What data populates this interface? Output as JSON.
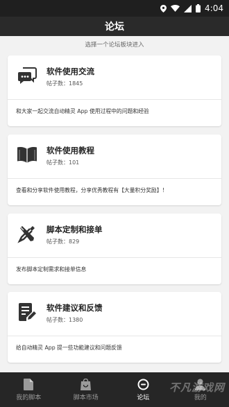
{
  "status_bar": {
    "time": "4:04"
  },
  "header": {
    "title": "论坛"
  },
  "subtitle": "选择一个论坛板块进入",
  "forums": [
    {
      "title": "软件使用交流",
      "count": "帖子数：1845",
      "description": "和大家一起交流自动精灵 App 使用过程中的问题和经验",
      "icon": "chat-icon"
    },
    {
      "title": "软件使用教程",
      "count": "帖子数：101",
      "description": "查看和分享软件使用教程，分享优秀教程有【大量积分奖励】！",
      "icon": "book-icon"
    },
    {
      "title": "脚本定制和接单",
      "count": "帖子数：829",
      "description": "发布脚本定制需求和接单信息",
      "icon": "tools-icon"
    },
    {
      "title": "软件建议和反馈",
      "count": "帖子数：1380",
      "description": "给自动精灵 App 提一些功能建议和问题反馈",
      "icon": "feedback-icon"
    }
  ],
  "bottom_nav": [
    {
      "label": "我的脚本",
      "icon": "document-icon"
    },
    {
      "label": "脚本市场",
      "icon": "shopping-bag-icon"
    },
    {
      "label": "论坛",
      "icon": "forum-icon",
      "active": true
    },
    {
      "label": "我的",
      "icon": "person-icon"
    }
  ],
  "watermark": "不凡游戏网"
}
